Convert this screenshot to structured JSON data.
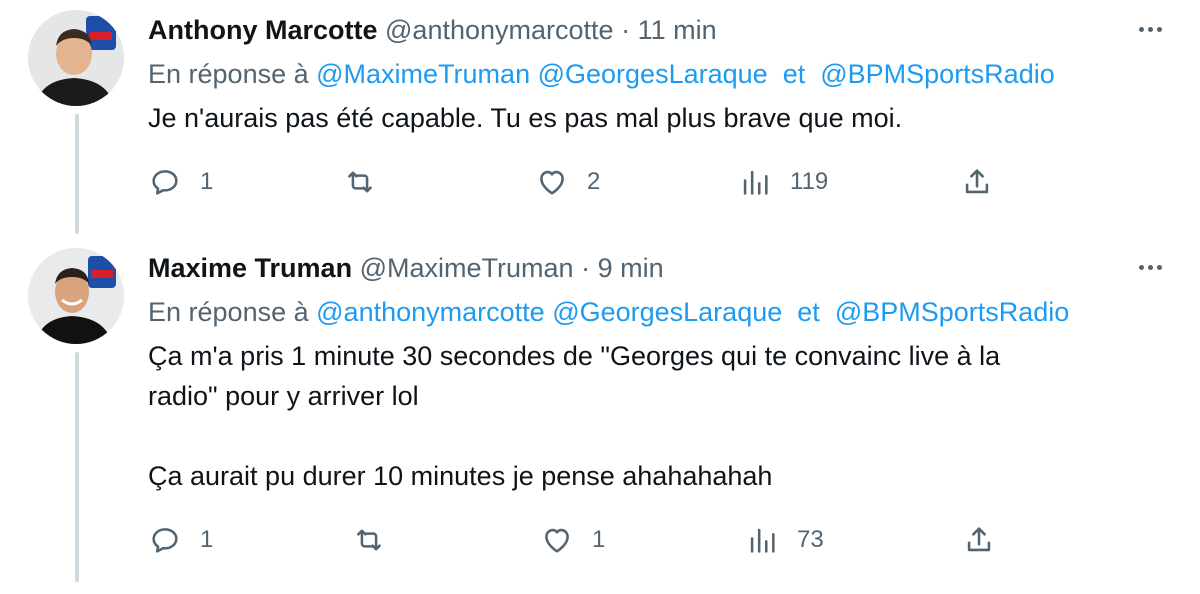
{
  "colors": {
    "text": "#0f1419",
    "secondary": "#536471",
    "link": "#1d9bf0",
    "thread_line": "#cfd9de"
  },
  "tweets": [
    {
      "author": {
        "name": "Anthony Marcotte",
        "handle": "@anthonymarcotte"
      },
      "separator": "·",
      "time": "11 min",
      "reply_prefix": "En réponse à",
      "mentions": [
        "@MaximeTruman",
        "@GeorgesLaraque",
        "@BPMSportsRadio"
      ],
      "conjunction": "et",
      "text_lines": [
        "Je n'aurais pas été capable. Tu es pas mal plus brave que moi."
      ],
      "stats": {
        "replies": "1",
        "likes": "2",
        "views": "119"
      }
    },
    {
      "author": {
        "name": "Maxime Truman",
        "handle": "@MaximeTruman"
      },
      "separator": "·",
      "time": "9 min",
      "reply_prefix": "En réponse à",
      "mentions": [
        "@anthonymarcotte",
        "@GeorgesLaraque",
        "@BPMSportsRadio"
      ],
      "conjunction": "et",
      "text_lines": [
        "Ça m'a pris 1 minute 30 secondes de \"Georges qui te convainc live à la",
        "radio\" pour y arriver lol",
        "Ça aurait pu durer 10 minutes je pense ahahahahah"
      ],
      "stats": {
        "replies": "1",
        "likes": "1",
        "views": "73"
      }
    }
  ],
  "icons": [
    "reply-icon",
    "retweet-icon",
    "like-icon",
    "views-icon",
    "share-icon",
    "more-icon"
  ]
}
